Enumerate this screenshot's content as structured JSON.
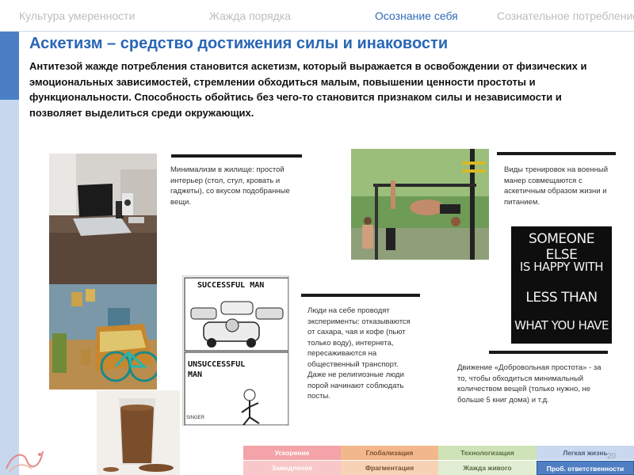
{
  "nav": {
    "tabs": [
      {
        "label": "Культура умеренности",
        "active": false
      },
      {
        "label": "Жажда порядка",
        "active": false
      },
      {
        "label": "Осознание себя",
        "active": true
      },
      {
        "label": "Сознательное потребление",
        "active": false
      }
    ]
  },
  "main": {
    "title": "Аскетизм – средство достижения силы и инаковости",
    "intro": "Антитезой жажде потребления  становится аскетизм, который выражается в освобождении от физических  и эмоциональных  зависимостей, стремлении  обходиться малым,  повышении  ценности простоты и функциональности.  Способность обойтись без чего-то становится признаком  силы и независимости и позволяет выделиться  среди окружающих."
  },
  "captions": {
    "minimalism": "Минимализм  в жилище:  простой интерьер (стол, стул, кровать и гаджеты), со вкусом подобранные вещи.",
    "training": "Виды тренировок  на военный манер совмещаются с аскетичным образом жизни  и питанием.",
    "experiments": "Люди на себе проводят эксперименты: отказываются от сахара, чая и кофе (пьют только воду), интернета, пересаживаются на общественный  транспорт. Даже не религиозные  люди порой начинают соблюдать посты.",
    "simplicity": "Движение «Добровольная простота» - за то, чтобы обходиться минимальный количеством вещей (только нужно, не больше 5 книг дома) и т.д."
  },
  "comic": {
    "top": "SUCCESSFUL MAN",
    "bottom_line1": "UNSUCCESSFUL",
    "bottom_line2": "MAN",
    "signature": "SINGER"
  },
  "poster": {
    "line1": "SOMEONE ELSE",
    "line2": "IS HAPPY WITH",
    "line3": "LESS THAN",
    "line4": "WHAT YOU HAVE"
  },
  "tags": {
    "row1": [
      "Ускорение",
      "Глобализация",
      "Технологизация",
      "Легкая жизнь"
    ],
    "row2": [
      "Замедление",
      "Фрагментация",
      "Жажда живого",
      "Проб. ответственности"
    ]
  },
  "page_number": "20",
  "colors": {
    "accent": "#2a66b5",
    "tab_active": "#2f6ab8",
    "tag_red_1": "#f4a3a8",
    "tag_red_2": "#f8c7c9",
    "tag_orange_1": "#f2b78a",
    "tag_orange_2": "#f8d2b4",
    "tag_green_1": "#cfe3b8",
    "tag_green_2": "#e1eed3",
    "tag_blue_1": "#c9d8ee",
    "tag_blue_2": "#4f7fc2"
  }
}
